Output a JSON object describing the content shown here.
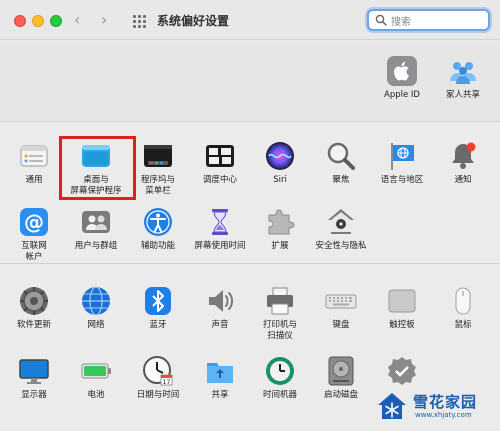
{
  "window": {
    "title": "系统偏好设置",
    "search_placeholder": "搜索"
  },
  "top_items": [
    {
      "label": "Apple ID",
      "icon": "apple-id-icon"
    },
    {
      "label": "家人共享",
      "icon": "family-sharing-icon"
    }
  ],
  "middle_items": [
    {
      "label": "通用",
      "icon": "general-icon"
    },
    {
      "label": "桌面与\n屏幕保护程序",
      "icon": "desktop-screensaver-icon",
      "highlighted": true
    },
    {
      "label": "程序坞与\n菜单栏",
      "icon": "dock-menubar-icon"
    },
    {
      "label": "调度中心",
      "icon": "mission-control-icon"
    },
    {
      "label": "Siri",
      "icon": "siri-icon"
    },
    {
      "label": "聚焦",
      "icon": "spotlight-icon"
    },
    {
      "label": "语言与地区",
      "icon": "language-region-icon"
    },
    {
      "label": "通知",
      "icon": "notifications-icon"
    },
    {
      "label": "互联网\n帐户",
      "icon": "internet-accounts-icon"
    },
    {
      "label": "用户与群组",
      "icon": "users-groups-icon"
    },
    {
      "label": "辅助功能",
      "icon": "accessibility-icon"
    },
    {
      "label": "屏幕使用时间",
      "icon": "screen-time-icon"
    },
    {
      "label": "扩展",
      "icon": "extensions-icon"
    },
    {
      "label": "安全性与隐私",
      "icon": "security-privacy-icon"
    }
  ],
  "bottom_items": [
    {
      "label": "软件更新",
      "icon": "software-update-icon"
    },
    {
      "label": "网络",
      "icon": "network-icon"
    },
    {
      "label": "蓝牙",
      "icon": "bluetooth-icon"
    },
    {
      "label": "声音",
      "icon": "sound-icon"
    },
    {
      "label": "打印机与\n扫描仪",
      "icon": "printers-scanners-icon"
    },
    {
      "label": "键盘",
      "icon": "keyboard-icon"
    },
    {
      "label": "触控板",
      "icon": "trackpad-icon"
    },
    {
      "label": "鼠标",
      "icon": "mouse-icon"
    },
    {
      "label": "显示器",
      "icon": "displays-icon"
    },
    {
      "label": "电池",
      "icon": "battery-icon"
    },
    {
      "label": "日期与时间",
      "icon": "date-time-icon"
    },
    {
      "label": "共享",
      "icon": "sharing-icon"
    },
    {
      "label": "时间机器",
      "icon": "time-machine-icon"
    },
    {
      "label": "启动磁盘",
      "icon": "startup-disk-icon"
    },
    {
      "label": "",
      "icon": "profiles-icon"
    }
  ],
  "watermark": {
    "text": "雪花家园",
    "url": "www.xhjaty.com"
  },
  "colors": {
    "highlight": "#e0201b",
    "search_focus": "#6aa3e8",
    "watermark": "#1a5fb4"
  }
}
